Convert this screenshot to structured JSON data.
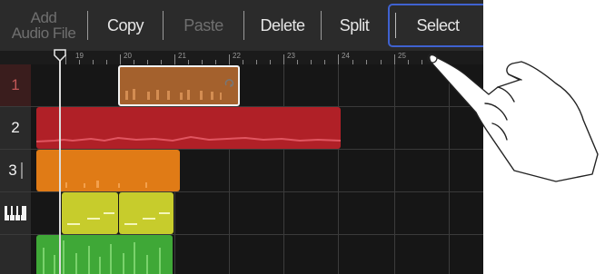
{
  "toolbar": {
    "add_line1": "Add",
    "add_line2": "Audio File",
    "copy": "Copy",
    "paste": "Paste",
    "delete": "Delete",
    "split": "Split",
    "select": "Select"
  },
  "ruler": {
    "bars": [
      "19",
      "20",
      "21",
      "22",
      "23",
      "24",
      "25"
    ]
  },
  "tracks": [
    {
      "label": "1",
      "type": "audio"
    },
    {
      "label": "2",
      "type": "audio"
    },
    {
      "label": "3",
      "type": "audio"
    },
    {
      "label": "",
      "type": "midi",
      "icon": "piano-keys-icon"
    },
    {
      "label": "",
      "type": "audio"
    }
  ],
  "colors": {
    "track1_region": "#a4612d",
    "track2_region": "#b02027",
    "track3_region": "#e07b16",
    "track4_region": "#c7cc2c",
    "track5_region": "#3fa837",
    "select_highlight": "#3f62d0"
  },
  "icons": [
    "loop-icon",
    "piano-keys-icon",
    "pointing-hand-icon"
  ]
}
